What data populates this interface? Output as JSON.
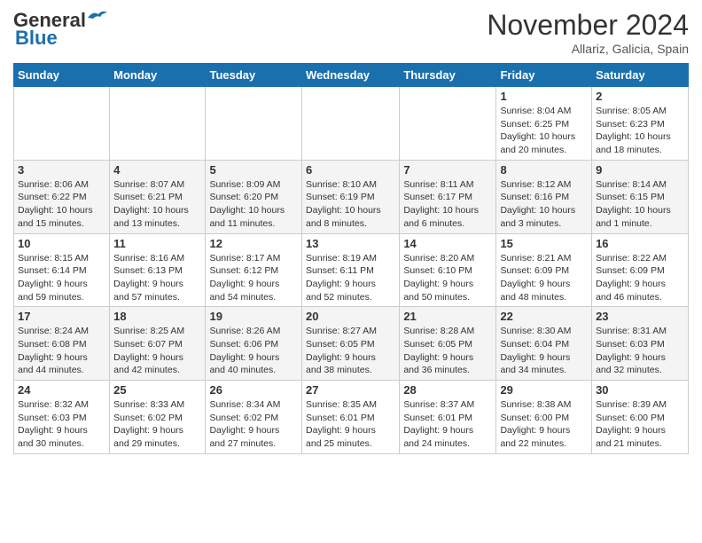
{
  "logo": {
    "part1": "General",
    "part2": "Blue"
  },
  "header": {
    "month": "November 2024",
    "location": "Allariz, Galicia, Spain"
  },
  "days_of_week": [
    "Sunday",
    "Monday",
    "Tuesday",
    "Wednesday",
    "Thursday",
    "Friday",
    "Saturday"
  ],
  "weeks": [
    [
      {
        "day": "",
        "info": ""
      },
      {
        "day": "",
        "info": ""
      },
      {
        "day": "",
        "info": ""
      },
      {
        "day": "",
        "info": ""
      },
      {
        "day": "",
        "info": ""
      },
      {
        "day": "1",
        "info": "Sunrise: 8:04 AM\nSunset: 6:25 PM\nDaylight: 10 hours\nand 20 minutes."
      },
      {
        "day": "2",
        "info": "Sunrise: 8:05 AM\nSunset: 6:23 PM\nDaylight: 10 hours\nand 18 minutes."
      }
    ],
    [
      {
        "day": "3",
        "info": "Sunrise: 8:06 AM\nSunset: 6:22 PM\nDaylight: 10 hours\nand 15 minutes."
      },
      {
        "day": "4",
        "info": "Sunrise: 8:07 AM\nSunset: 6:21 PM\nDaylight: 10 hours\nand 13 minutes."
      },
      {
        "day": "5",
        "info": "Sunrise: 8:09 AM\nSunset: 6:20 PM\nDaylight: 10 hours\nand 11 minutes."
      },
      {
        "day": "6",
        "info": "Sunrise: 8:10 AM\nSunset: 6:19 PM\nDaylight: 10 hours\nand 8 minutes."
      },
      {
        "day": "7",
        "info": "Sunrise: 8:11 AM\nSunset: 6:17 PM\nDaylight: 10 hours\nand 6 minutes."
      },
      {
        "day": "8",
        "info": "Sunrise: 8:12 AM\nSunset: 6:16 PM\nDaylight: 10 hours\nand 3 minutes."
      },
      {
        "day": "9",
        "info": "Sunrise: 8:14 AM\nSunset: 6:15 PM\nDaylight: 10 hours\nand 1 minute."
      }
    ],
    [
      {
        "day": "10",
        "info": "Sunrise: 8:15 AM\nSunset: 6:14 PM\nDaylight: 9 hours\nand 59 minutes."
      },
      {
        "day": "11",
        "info": "Sunrise: 8:16 AM\nSunset: 6:13 PM\nDaylight: 9 hours\nand 57 minutes."
      },
      {
        "day": "12",
        "info": "Sunrise: 8:17 AM\nSunset: 6:12 PM\nDaylight: 9 hours\nand 54 minutes."
      },
      {
        "day": "13",
        "info": "Sunrise: 8:19 AM\nSunset: 6:11 PM\nDaylight: 9 hours\nand 52 minutes."
      },
      {
        "day": "14",
        "info": "Sunrise: 8:20 AM\nSunset: 6:10 PM\nDaylight: 9 hours\nand 50 minutes."
      },
      {
        "day": "15",
        "info": "Sunrise: 8:21 AM\nSunset: 6:09 PM\nDaylight: 9 hours\nand 48 minutes."
      },
      {
        "day": "16",
        "info": "Sunrise: 8:22 AM\nSunset: 6:09 PM\nDaylight: 9 hours\nand 46 minutes."
      }
    ],
    [
      {
        "day": "17",
        "info": "Sunrise: 8:24 AM\nSunset: 6:08 PM\nDaylight: 9 hours\nand 44 minutes."
      },
      {
        "day": "18",
        "info": "Sunrise: 8:25 AM\nSunset: 6:07 PM\nDaylight: 9 hours\nand 42 minutes."
      },
      {
        "day": "19",
        "info": "Sunrise: 8:26 AM\nSunset: 6:06 PM\nDaylight: 9 hours\nand 40 minutes."
      },
      {
        "day": "20",
        "info": "Sunrise: 8:27 AM\nSunset: 6:05 PM\nDaylight: 9 hours\nand 38 minutes."
      },
      {
        "day": "21",
        "info": "Sunrise: 8:28 AM\nSunset: 6:05 PM\nDaylight: 9 hours\nand 36 minutes."
      },
      {
        "day": "22",
        "info": "Sunrise: 8:30 AM\nSunset: 6:04 PM\nDaylight: 9 hours\nand 34 minutes."
      },
      {
        "day": "23",
        "info": "Sunrise: 8:31 AM\nSunset: 6:03 PM\nDaylight: 9 hours\nand 32 minutes."
      }
    ],
    [
      {
        "day": "24",
        "info": "Sunrise: 8:32 AM\nSunset: 6:03 PM\nDaylight: 9 hours\nand 30 minutes."
      },
      {
        "day": "25",
        "info": "Sunrise: 8:33 AM\nSunset: 6:02 PM\nDaylight: 9 hours\nand 29 minutes."
      },
      {
        "day": "26",
        "info": "Sunrise: 8:34 AM\nSunset: 6:02 PM\nDaylight: 9 hours\nand 27 minutes."
      },
      {
        "day": "27",
        "info": "Sunrise: 8:35 AM\nSunset: 6:01 PM\nDaylight: 9 hours\nand 25 minutes."
      },
      {
        "day": "28",
        "info": "Sunrise: 8:37 AM\nSunset: 6:01 PM\nDaylight: 9 hours\nand 24 minutes."
      },
      {
        "day": "29",
        "info": "Sunrise: 8:38 AM\nSunset: 6:00 PM\nDaylight: 9 hours\nand 22 minutes."
      },
      {
        "day": "30",
        "info": "Sunrise: 8:39 AM\nSunset: 6:00 PM\nDaylight: 9 hours\nand 21 minutes."
      }
    ]
  ]
}
